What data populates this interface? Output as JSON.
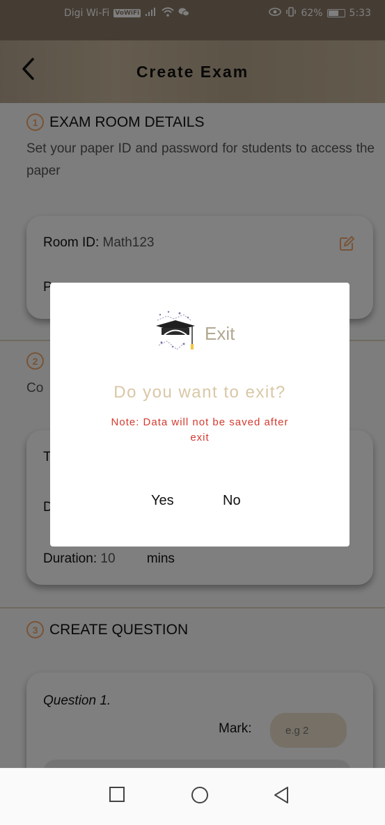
{
  "status_bar": {
    "carrier": "Digi Wi-Fi",
    "vowifi_badge": "VoWiFi",
    "battery_percent": "62%",
    "time": "5:33"
  },
  "header": {
    "back_icon": "chevron-left-icon",
    "title": "Create Exam"
  },
  "section1": {
    "number": "1",
    "title": "EXAM ROOM DETAILS",
    "description": "Set your paper ID and password for students to access the paper",
    "room_id_label": "Room ID:",
    "room_id_value": "Math123",
    "password_label_partial": "P"
  },
  "section2": {
    "number": "2",
    "description_partial": "Co",
    "field1_partial": "T",
    "field2_partial": "D",
    "duration_label": "Duration:",
    "duration_value": "10",
    "duration_unit": "mins"
  },
  "section3": {
    "number": "3",
    "title": "CREATE QUESTION",
    "question_label": "Question 1.",
    "mark_label": "Mark:",
    "mark_placeholder": "e.g 2"
  },
  "dialog": {
    "icon": "graduation-cap-icon",
    "title": "Exit",
    "question": "Do you want to exit?",
    "note": "Note: Data will not be saved after exit",
    "yes_label": "Yes",
    "no_label": "No"
  },
  "colors": {
    "accent_orange": "#f2a86d",
    "header_tan": "#c2b197",
    "note_red": "#d33a2f"
  },
  "nav": {
    "recents_icon": "square-icon",
    "home_icon": "circle-icon",
    "back_icon": "triangle-back-icon"
  }
}
